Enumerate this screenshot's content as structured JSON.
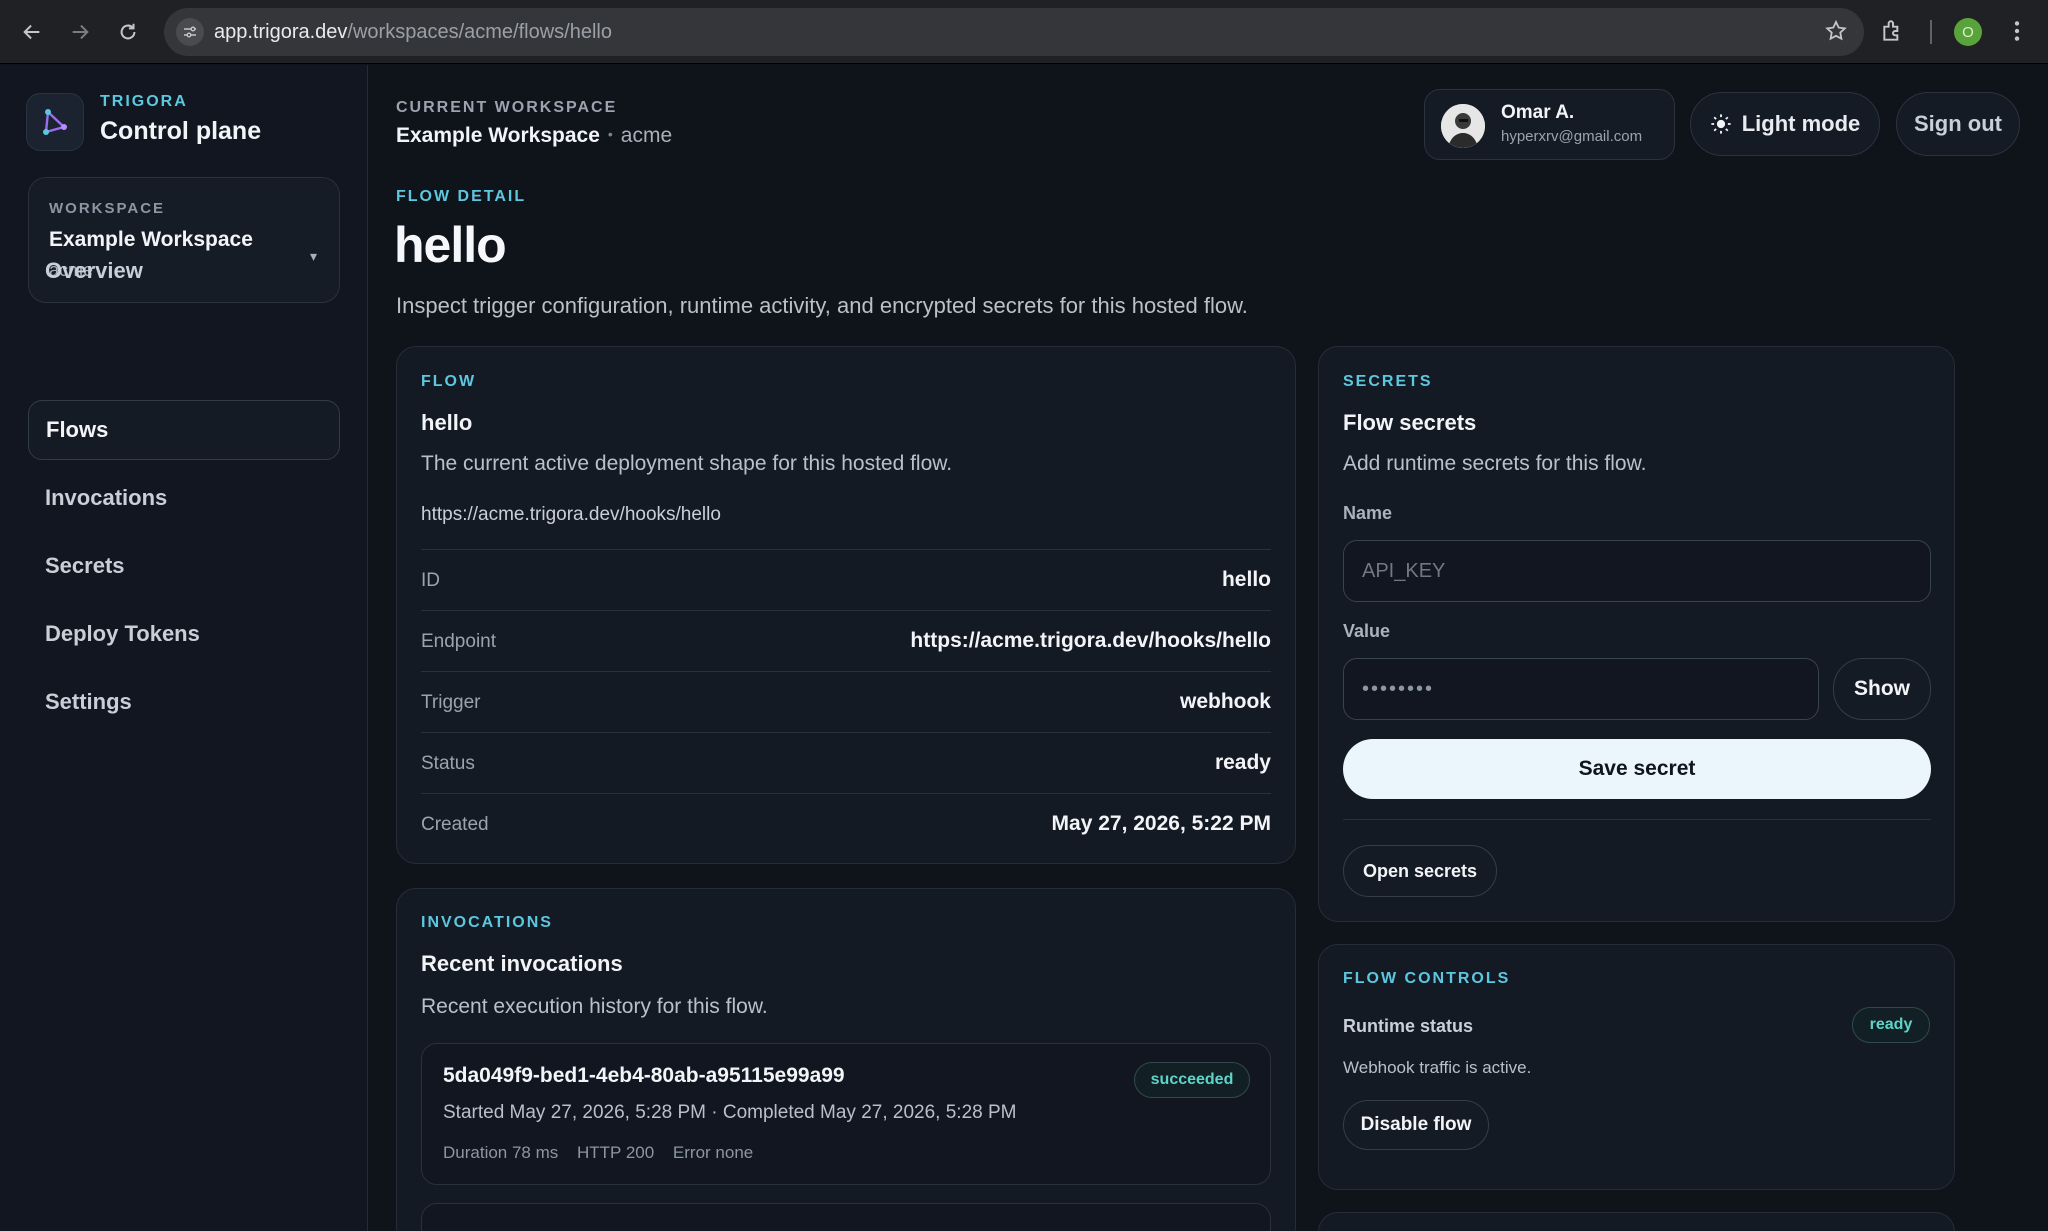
{
  "browser": {
    "url_host": "app.trigora.dev",
    "url_path": "/workspaces/acme/flows/hello",
    "profile_initial": "O"
  },
  "sidebar": {
    "brand_small": "TRIGORA",
    "brand_title": "Control plane",
    "workspace": {
      "eyebrow": "WORKSPACE",
      "name": "Example Workspace",
      "slug": "acme",
      "caret": "▾"
    },
    "items": [
      {
        "label": "Overview"
      },
      {
        "label": "Flows",
        "active": true
      },
      {
        "label": "Invocations"
      },
      {
        "label": "Secrets"
      },
      {
        "label": "Deploy Tokens"
      },
      {
        "label": "Settings"
      }
    ]
  },
  "header": {
    "eyebrow": "CURRENT WORKSPACE",
    "workspace_name": "Example Workspace",
    "separator": "•",
    "workspace_slug": "acme",
    "user": {
      "name": "Omar A.",
      "email": "hyperxrv@gmail.com"
    },
    "light_mode_label": "Light mode",
    "sign_out_label": "Sign out"
  },
  "page": {
    "eyebrow": "FLOW DETAIL",
    "title": "hello",
    "description": "Inspect trigger configuration, runtime activity, and encrypted secrets for this hosted flow."
  },
  "flow_panel": {
    "eyebrow": "FLOW",
    "title": "hello",
    "subtitle": "The current active deployment shape for this hosted flow.",
    "url": "https://acme.trigora.dev/hooks/hello",
    "rows": [
      {
        "key": "ID",
        "value": "hello"
      },
      {
        "key": "Endpoint",
        "value": "https://acme.trigora.dev/hooks/hello"
      },
      {
        "key": "Trigger",
        "value": "webhook"
      },
      {
        "key": "Status",
        "value": "ready"
      },
      {
        "key": "Created",
        "value": "May 27, 2026, 5:22 PM"
      }
    ]
  },
  "secrets_panel": {
    "eyebrow": "SECRETS",
    "title": "Flow secrets",
    "subtitle": "Add runtime secrets for this flow.",
    "name_label": "Name",
    "name_placeholder": "API_KEY",
    "value_label": "Value",
    "value_masked": "••••••••",
    "show_label": "Show",
    "save_label": "Save secret",
    "open_label": "Open secrets"
  },
  "invocations_panel": {
    "eyebrow": "INVOCATIONS",
    "title": "Recent invocations",
    "subtitle": "Recent execution history for this flow.",
    "items": [
      {
        "id": "5da049f9-bed1-4eb4-80ab-a95115e99a99",
        "status": "succeeded",
        "timing": "Started May 27, 2026, 5:28 PM · Completed May 27, 2026, 5:28 PM",
        "duration": "Duration 78 ms",
        "http": "HTTP 200",
        "error": "Error none"
      }
    ]
  },
  "controls_panel": {
    "eyebrow": "FLOW CONTROLS",
    "runtime_label": "Runtime status",
    "runtime_status": "ready",
    "runtime_desc": "Webhook traffic is active.",
    "disable_label": "Disable flow"
  },
  "colors": {
    "accent": "#5cc8e0",
    "success": "#5fd4c6",
    "background": "#0f131a",
    "panel": "#141a24"
  }
}
